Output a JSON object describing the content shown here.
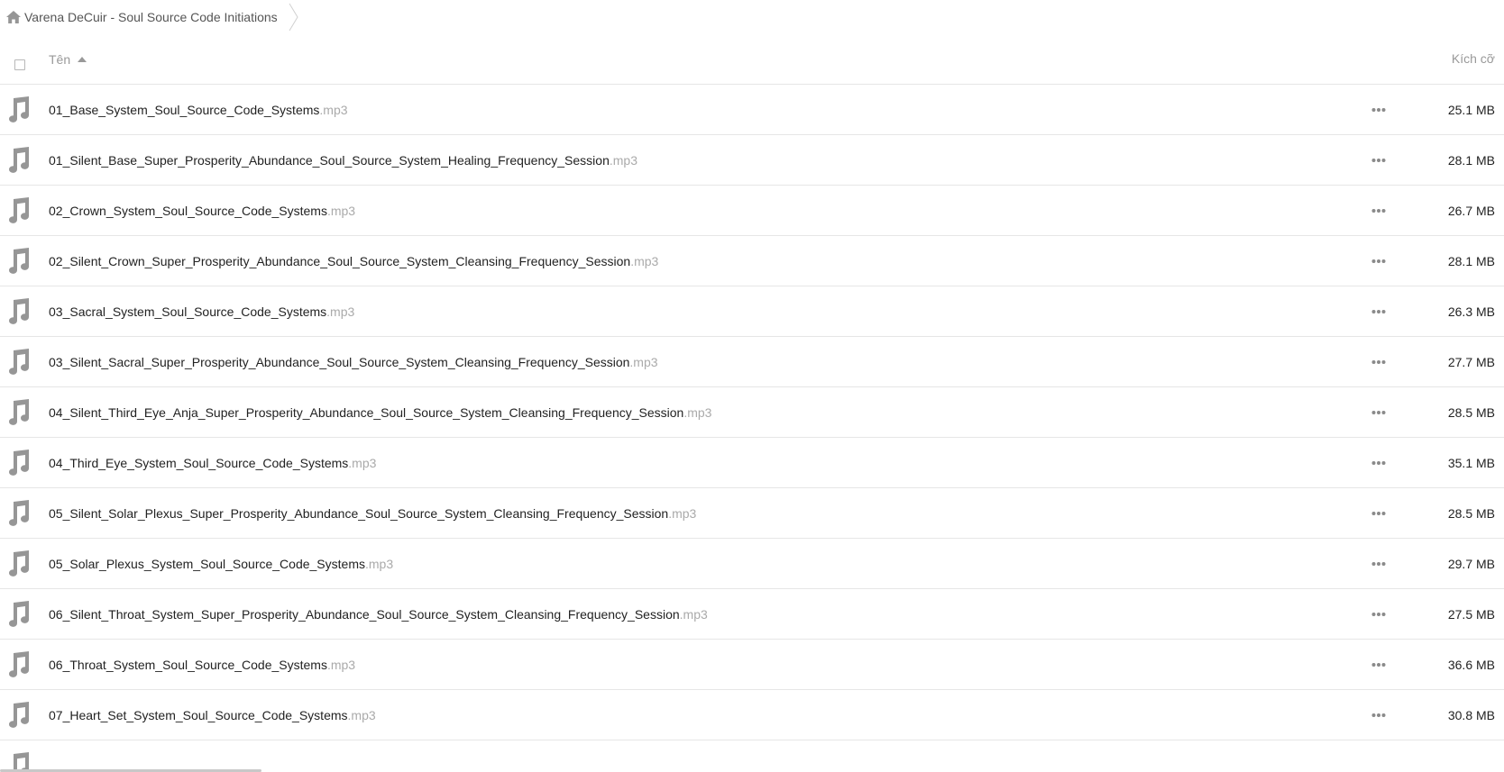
{
  "breadcrumb": {
    "folder_name": "Varena DeCuir - Soul Source Code Initiations"
  },
  "header": {
    "name_label": "Tên",
    "size_label": "Kích cỡ"
  },
  "files": [
    {
      "name": "01_Base_System_Soul_Source_Code_Systems",
      "ext": ".mp3",
      "size": "25.1 MB"
    },
    {
      "name": "01_Silent_Base_Super_Prosperity_Abundance_Soul_Source_System_Healing_Frequency_Session",
      "ext": ".mp3",
      "size": "28.1 MB"
    },
    {
      "name": "02_Crown_System_Soul_Source_Code_Systems",
      "ext": ".mp3",
      "size": "26.7 MB"
    },
    {
      "name": "02_Silent_Crown_Super_Prosperity_Abundance_Soul_Source_System_Cleansing_Frequency_Session",
      "ext": ".mp3",
      "size": "28.1 MB"
    },
    {
      "name": "03_Sacral_System_Soul_Source_Code_Systems",
      "ext": ".mp3",
      "size": "26.3 MB"
    },
    {
      "name": "03_Silent_Sacral_Super_Prosperity_Abundance_Soul_Source_System_Cleansing_Frequency_Session",
      "ext": ".mp3",
      "size": "27.7 MB"
    },
    {
      "name": "04_Silent_Third_Eye_Anja_Super_Prosperity_Abundance_Soul_Source_System_Cleansing_Frequency_Session",
      "ext": ".mp3",
      "size": "28.5 MB"
    },
    {
      "name": "04_Third_Eye_System_Soul_Source_Code_Systems",
      "ext": ".mp3",
      "size": "35.1 MB"
    },
    {
      "name": "05_Silent_Solar_Plexus_Super_Prosperity_Abundance_Soul_Source_System_Cleansing_Frequency_Session",
      "ext": ".mp3",
      "size": "28.5 MB"
    },
    {
      "name": "05_Solar_Plexus_System_Soul_Source_Code_Systems",
      "ext": ".mp3",
      "size": "29.7 MB"
    },
    {
      "name": "06_Silent_Throat_System_Super_Prosperity_Abundance_Soul_Source_System_Cleansing_Frequency_Session",
      "ext": ".mp3",
      "size": "27.5 MB"
    },
    {
      "name": "06_Throat_System_Soul_Source_Code_Systems",
      "ext": ".mp3",
      "size": "36.6 MB"
    },
    {
      "name": "07_Heart_Set_System_Soul_Source_Code_Systems",
      "ext": ".mp3",
      "size": "30.8 MB"
    }
  ],
  "icons": {
    "home": "home-icon",
    "file": "music-note-icon",
    "more": "more-horizontal-icon",
    "sort": "sort-ascending-icon",
    "separator": "chevron-right-icon"
  },
  "colors": {
    "icon_gray": "#969696",
    "ext_gray": "#aaaaaa",
    "divider": "#e6e6e6"
  }
}
